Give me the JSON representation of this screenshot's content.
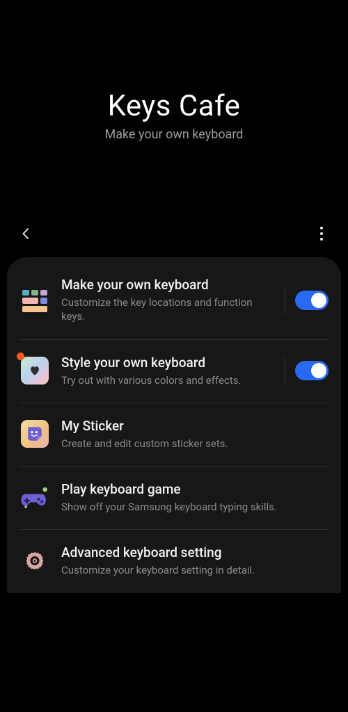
{
  "hero": {
    "title": "Keys Cafe",
    "subtitle": "Make your own keyboard"
  },
  "rows": [
    {
      "title": "Make your own keyboard",
      "desc": "Customize the key locations and function keys.",
      "toggle": true
    },
    {
      "title": "Style your own keyboard",
      "desc": "Try out with various colors and effects.",
      "toggle": true
    },
    {
      "title": "My Sticker",
      "desc": "Create and edit custom sticker sets."
    },
    {
      "title": "Play keyboard game",
      "desc": "Show off your Samsung keyboard typing skills."
    },
    {
      "title": "Advanced keyboard setting",
      "desc": "Customize your keyboard setting in detail."
    }
  ]
}
